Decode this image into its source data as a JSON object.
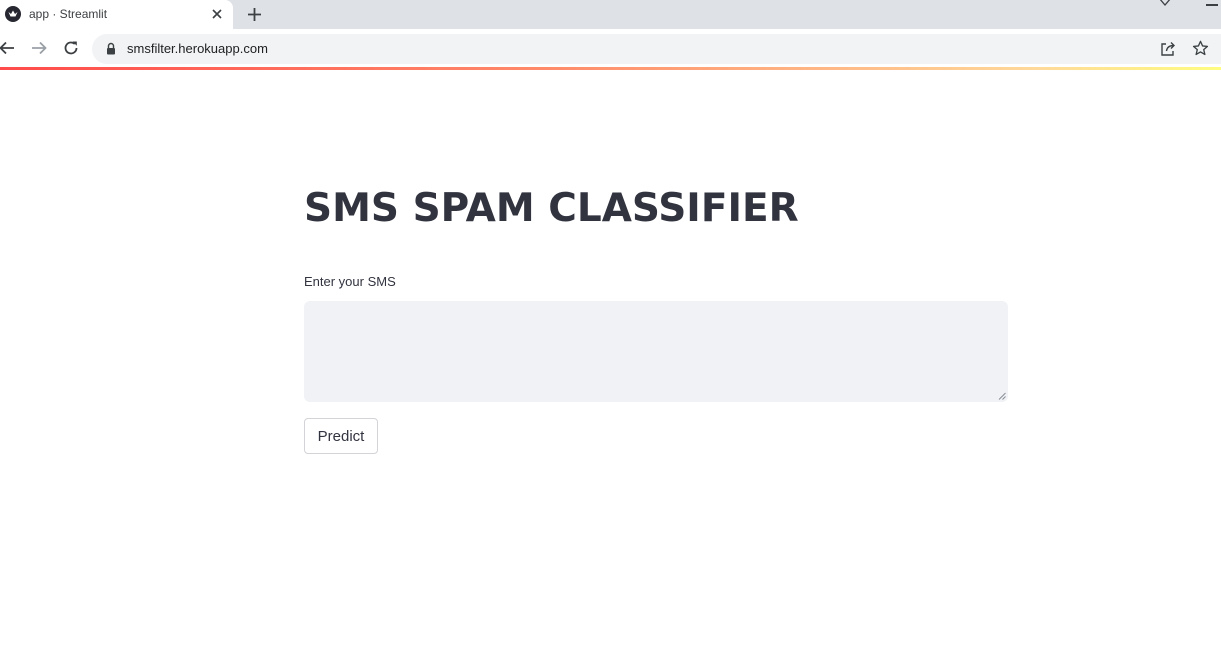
{
  "browser": {
    "tab": {
      "title": "app · Streamlit",
      "favicon": "streamlit-crown-icon",
      "close_icon": "close-icon"
    },
    "new_tab_icon": "plus-icon",
    "toolbar": {
      "back_icon": "arrow-left-icon",
      "forward_icon": "arrow-right-icon",
      "reload_icon": "reload-icon",
      "lock_icon": "lock-icon",
      "url": "smsfilter.herokuapp.com",
      "share_icon": "share-icon",
      "bookmark_icon": "star-icon"
    },
    "colors": {
      "tabstrip": "#dee1e6",
      "omnibox": "#f1f3f4"
    }
  },
  "app": {
    "title": "SMS SPAM CLASSIFIER",
    "input": {
      "label": "Enter your SMS",
      "value": "",
      "placeholder": ""
    },
    "predict_button": "Predict",
    "colors": {
      "text": "#31333f",
      "input_bg": "#f0f2f6",
      "accent_gradient_start": "#ff4b4b",
      "accent_gradient_end": "#fffd80"
    }
  }
}
